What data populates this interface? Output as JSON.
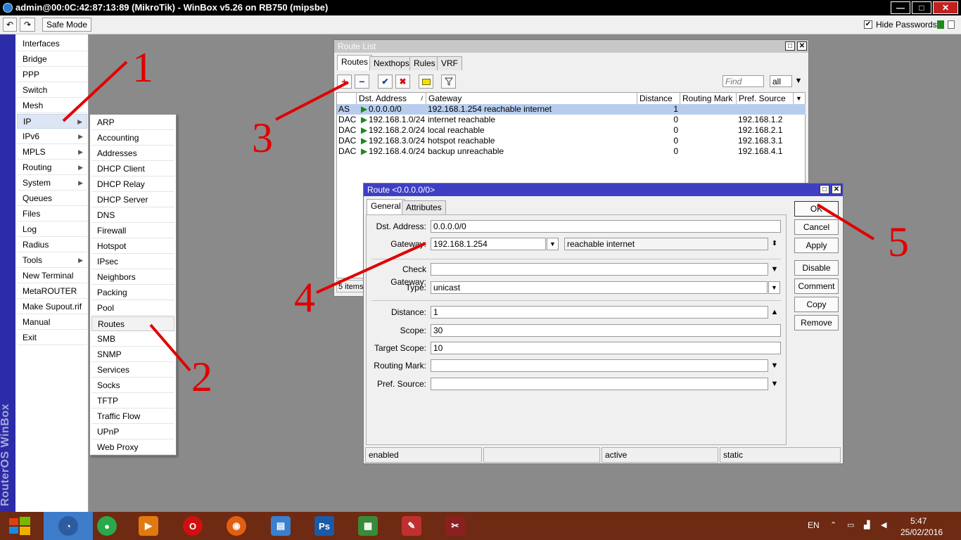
{
  "window": {
    "title": "admin@00:0C:42:87:13:89 (MikroTik) - WinBox v5.26 on RB750 (mipsbe)"
  },
  "toolbar": {
    "undo_label": "↶",
    "redo_label": "↷",
    "safe_mode_label": "Safe Mode",
    "hide_passwords_label": "Hide Passwords",
    "hide_passwords_checked": "✔"
  },
  "brand": {
    "text": "RouterOS WinBox"
  },
  "main_menu": [
    {
      "label": "Interfaces"
    },
    {
      "label": "Bridge"
    },
    {
      "label": "PPP"
    },
    {
      "label": "Switch"
    },
    {
      "label": "Mesh"
    },
    {
      "label": "IP",
      "arrow": "▶"
    },
    {
      "label": "IPv6",
      "arrow": "▶"
    },
    {
      "label": "MPLS",
      "arrow": "▶"
    },
    {
      "label": "Routing",
      "arrow": "▶"
    },
    {
      "label": "System",
      "arrow": "▶"
    },
    {
      "label": "Queues"
    },
    {
      "label": "Files"
    },
    {
      "label": "Log"
    },
    {
      "label": "Radius"
    },
    {
      "label": "Tools",
      "arrow": "▶"
    },
    {
      "label": "New Terminal"
    },
    {
      "label": "MetaROUTER"
    },
    {
      "label": "Make Supout.rif"
    },
    {
      "label": "Manual"
    },
    {
      "label": "Exit"
    }
  ],
  "ip_submenu": [
    {
      "label": "ARP"
    },
    {
      "label": "Accounting"
    },
    {
      "label": "Addresses"
    },
    {
      "label": "DHCP Client"
    },
    {
      "label": "DHCP Relay"
    },
    {
      "label": "DHCP Server"
    },
    {
      "label": "DNS"
    },
    {
      "label": "Firewall"
    },
    {
      "label": "Hotspot"
    },
    {
      "label": "IPsec"
    },
    {
      "label": "Neighbors"
    },
    {
      "label": "Packing"
    },
    {
      "label": "Pool"
    },
    {
      "label": "Routes"
    },
    {
      "label": "SMB"
    },
    {
      "label": "SNMP"
    },
    {
      "label": "Services"
    },
    {
      "label": "Socks"
    },
    {
      "label": "TFTP"
    },
    {
      "label": "Traffic Flow"
    },
    {
      "label": "UPnP"
    },
    {
      "label": "Web Proxy"
    }
  ],
  "route_list": {
    "title": "Route List",
    "restore_icon": "□",
    "close_icon": "✕",
    "tabs": [
      "Routes",
      "Nexthops",
      "Rules",
      "VRF"
    ],
    "add_icon": "+",
    "remove_icon": "−",
    "enable_icon": "✔",
    "disable_icon": "✖",
    "find_placeholder": "Find",
    "filter_value": "all",
    "columns": [
      "",
      "Dst. Address",
      "Gateway",
      "Distance",
      "Routing Mark",
      "Pref. Source"
    ],
    "rows": [
      {
        "flags": "AS",
        "dst": "0.0.0.0/0",
        "gateway": "192.168.1.254 reachable internet",
        "distance": "1",
        "mark": "",
        "pref": ""
      },
      {
        "flags": "DAC",
        "dst": "192.168.1.0/24",
        "gateway": "internet reachable",
        "distance": "0",
        "mark": "",
        "pref": "192.168.1.2"
      },
      {
        "flags": "DAC",
        "dst": "192.168.2.0/24",
        "gateway": "local reachable",
        "distance": "0",
        "mark": "",
        "pref": "192.168.2.1"
      },
      {
        "flags": "DAC",
        "dst": "192.168.3.0/24",
        "gateway": "hotspot reachable",
        "distance": "0",
        "mark": "",
        "pref": "192.168.3.1"
      },
      {
        "flags": "DAC",
        "dst": "192.168.4.0/24",
        "gateway": "backup unreachable",
        "distance": "0",
        "mark": "",
        "pref": "192.168.4.1"
      }
    ],
    "items_count": "5 items"
  },
  "route_dialog": {
    "title": "Route <0.0.0.0/0>",
    "restore_icon": "□",
    "close_icon": "✕",
    "tabs": [
      "General",
      "Attributes"
    ],
    "fields": {
      "dst_label": "Dst. Address:",
      "dst_value": "0.0.0.0/0",
      "gateway_label": "Gateway:",
      "gateway_value": "192.168.1.254",
      "gateway_state": "reachable internet",
      "check_gateway_label": "Check Gateway:",
      "check_gateway_value": "",
      "type_label": "Type:",
      "type_value": "unicast",
      "distance_label": "Distance:",
      "distance_value": "1",
      "scope_label": "Scope:",
      "scope_value": "30",
      "target_scope_label": "Target Scope:",
      "target_scope_value": "10",
      "routing_mark_label": "Routing Mark:",
      "routing_mark_value": "",
      "pref_source_label": "Pref. Source:",
      "pref_source_value": ""
    },
    "buttons": [
      "OK",
      "Cancel",
      "Apply",
      "Disable",
      "Comment",
      "Copy",
      "Remove"
    ],
    "status": [
      "enabled",
      "",
      "active",
      "static"
    ]
  },
  "annotations": [
    "1",
    "2",
    "3",
    "4",
    "5"
  ],
  "annotation_color": "#e00000",
  "taskbar": {
    "apps": [
      {
        "name": "winbox",
        "glyph": "◔",
        "color": "#3a7fd0"
      },
      {
        "name": "chrome",
        "glyph": "●",
        "color": "#2aa84a"
      },
      {
        "name": "media-player",
        "glyph": "▶",
        "color": "#e07a10"
      },
      {
        "name": "opera",
        "glyph": "O",
        "color": "#d01010"
      },
      {
        "name": "firefox",
        "glyph": "◉",
        "color": "#e06010"
      },
      {
        "name": "file-explorer",
        "glyph": "▤",
        "color": "#3a7fd0"
      },
      {
        "name": "photoshop",
        "glyph": "Ps",
        "color": "#1c5aa8"
      },
      {
        "name": "system-monitor",
        "glyph": "▦",
        "color": "#3a8a3a"
      },
      {
        "name": "paint",
        "glyph": "✎",
        "color": "#c03030"
      },
      {
        "name": "scissors-tool",
        "glyph": "✂",
        "color": "#8a2020"
      }
    ],
    "language": "EN",
    "time": "5:47",
    "date": "25/02/2016"
  }
}
